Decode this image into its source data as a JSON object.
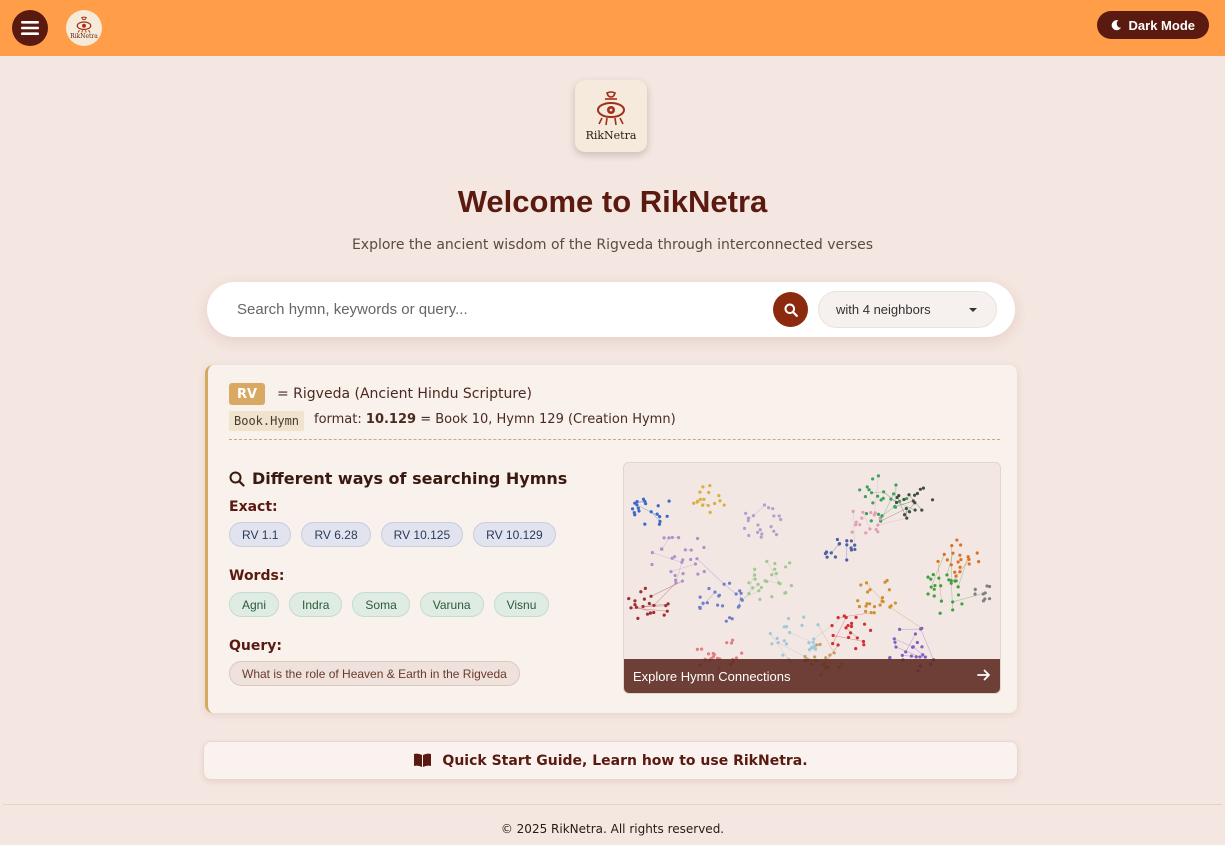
{
  "nav": {
    "logo_text": "RikNetra",
    "dark_mode_label": "Dark Mode"
  },
  "hero": {
    "logo_text": "RikNetra",
    "title": "Welcome to RikNetra",
    "subtitle": "Explore the ancient wisdom of the Rigveda through interconnected verses"
  },
  "search": {
    "placeholder": "Search hymn, keywords or query...",
    "value": "",
    "neighbors_selected": "with 4 neighbors"
  },
  "info": {
    "rv_badge": "RV",
    "rv_text": "= Rigveda (Ancient Hindu Scripture)",
    "book_code": "Book.Hymn",
    "book_format_prefix": "format:",
    "book_example": "10.129",
    "book_example_desc": "= Book 10, Hymn 129 (Creation Hymn)"
  },
  "ways": {
    "title": "Different ways of searching Hymns",
    "exact_label": "Exact:",
    "exact": [
      "RV 1.1",
      "RV 6.28",
      "RV 10.125",
      "RV 10.129"
    ],
    "words_label": "Words:",
    "words": [
      "Agni",
      "Indra",
      "Soma",
      "Varuna",
      "Visnu"
    ],
    "query_label": "Query:",
    "query": "What is the role of Heaven & Earth in the Rigveda"
  },
  "graph": {
    "cta": "Explore Hymn Connections"
  },
  "guide": {
    "label": "Quick Start Guide, Learn how to use RikNetra."
  },
  "footer": {
    "copyright": "© 2025 RikNetra. All rights reserved."
  },
  "colors": {
    "topbar": "#ff9d48",
    "accent_dark": "#5a1a10",
    "search_button": "#8c2a10",
    "page_bg": "#f4e6e0",
    "rv_badge": "#d9a863"
  },
  "icons": {
    "menu": "menu-icon",
    "moon": "moon-icon",
    "search": "search-icon",
    "book": "book-icon",
    "arrow": "arrow-right-icon"
  }
}
